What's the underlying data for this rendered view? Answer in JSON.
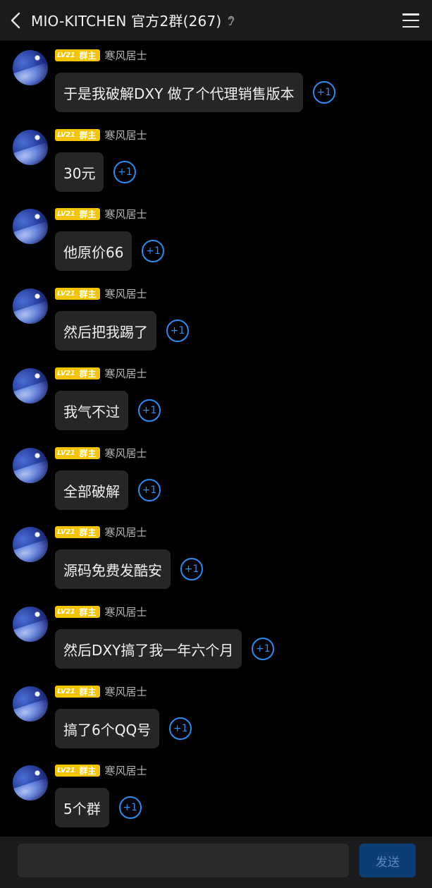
{
  "header": {
    "back_icon": "chevron-left-icon",
    "title": "MIO-KITCHEN 官方2群(267)",
    "status_icon": "ear-icon",
    "menu_icon": "menu-icon"
  },
  "messages": [
    {
      "level": "LV21",
      "role": "群主",
      "sender": "寒风居士",
      "text": "于是我破解DXY 做了个代理销售版本",
      "plus_one": "+1"
    },
    {
      "level": "LV21",
      "role": "群主",
      "sender": "寒风居士",
      "text": "30元",
      "plus_one": "+1"
    },
    {
      "level": "LV21",
      "role": "群主",
      "sender": "寒风居士",
      "text": "他原价66",
      "plus_one": "+1"
    },
    {
      "level": "LV21",
      "role": "群主",
      "sender": "寒风居士",
      "text": "然后把我踢了",
      "plus_one": "+1"
    },
    {
      "level": "LV21",
      "role": "群主",
      "sender": "寒风居士",
      "text": "我气不过",
      "plus_one": "+1"
    },
    {
      "level": "LV21",
      "role": "群主",
      "sender": "寒风居士",
      "text": "全部破解",
      "plus_one": "+1"
    },
    {
      "level": "LV21",
      "role": "群主",
      "sender": "寒风居士",
      "text": "源码免费发酷安",
      "plus_one": "+1"
    },
    {
      "level": "LV21",
      "role": "群主",
      "sender": "寒风居士",
      "text": "然后DXY搞了我一年六个月",
      "plus_one": "+1"
    },
    {
      "level": "LV21",
      "role": "群主",
      "sender": "寒风居士",
      "text": "搞了6个QQ号",
      "plus_one": "+1"
    },
    {
      "level": "LV21",
      "role": "群主",
      "sender": "寒风居士",
      "text": "5个群",
      "plus_one": "+1"
    }
  ],
  "input": {
    "value": "",
    "send_label": "发送"
  },
  "colors": {
    "background": "#000000",
    "bar": "#1b1b1d",
    "bubble": "#262628",
    "badge": "#f5c400",
    "accent": "#2a8cf0",
    "send_button": "#0d3d75"
  }
}
